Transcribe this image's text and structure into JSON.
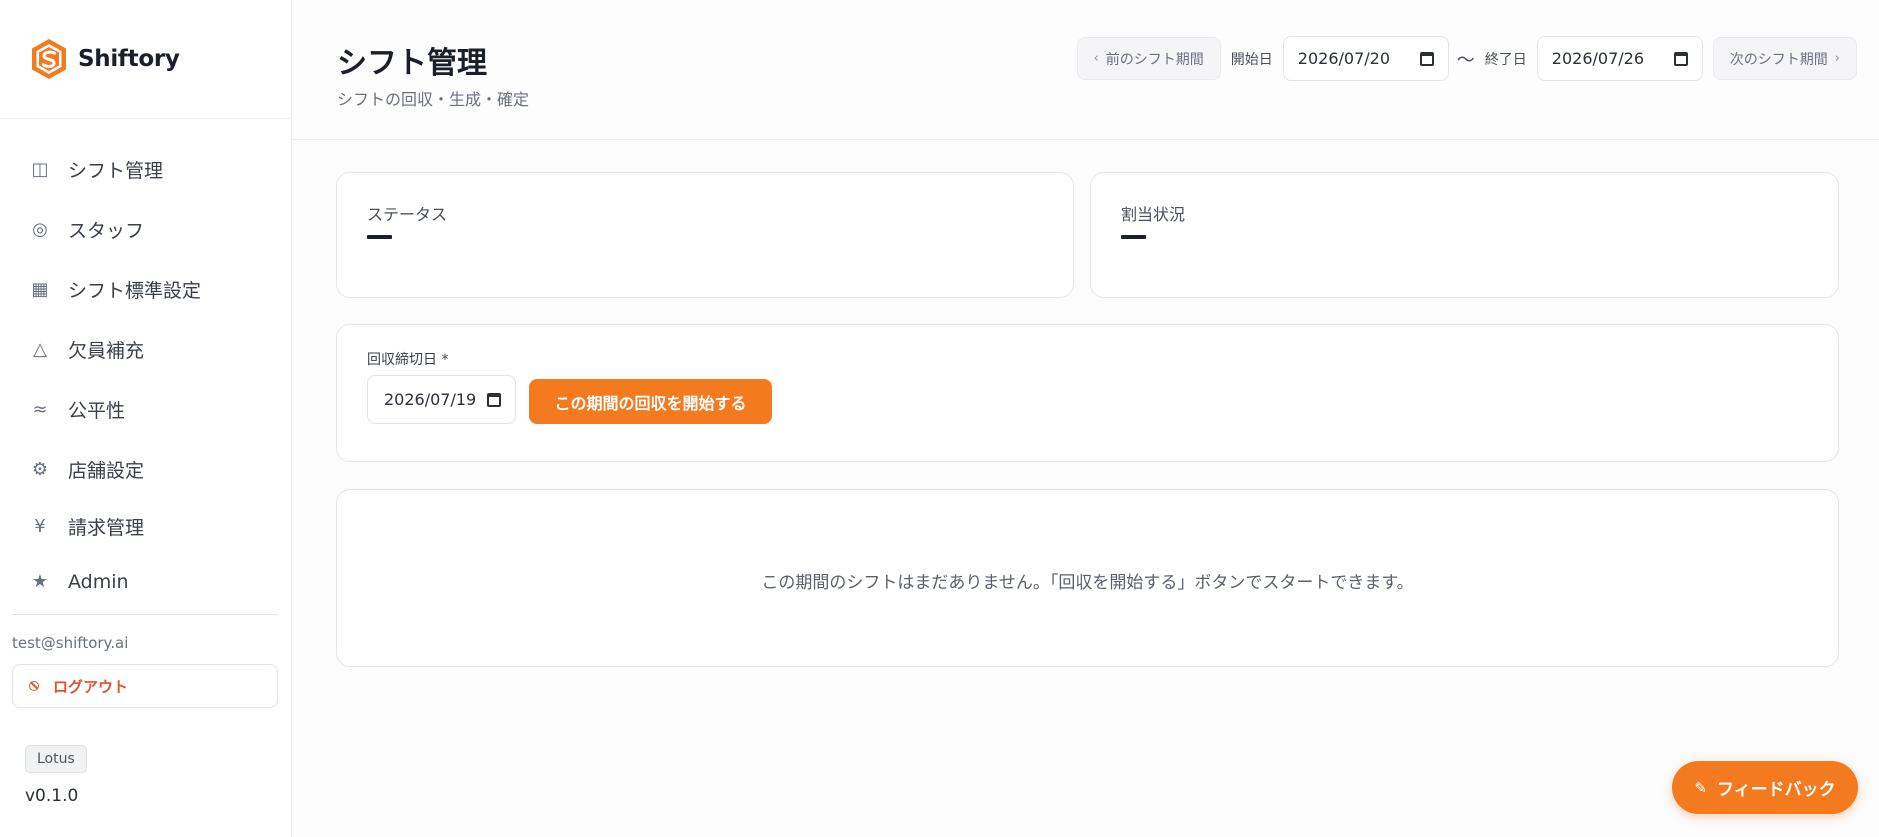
{
  "brand": {
    "name": "Shiftory",
    "accent": "#f47a20"
  },
  "sidebar": {
    "items": [
      {
        "label": "シフト管理",
        "icon": "columns-icon",
        "glyph": "◫"
      },
      {
        "label": "スタッフ",
        "icon": "target-icon",
        "glyph": "◎"
      },
      {
        "label": "シフト標準設定",
        "icon": "grid-icon",
        "glyph": "▦"
      },
      {
        "label": "欠員補充",
        "icon": "triangle-icon",
        "glyph": "△"
      },
      {
        "label": "公平性",
        "icon": "approx-icon",
        "glyph": "≈"
      },
      {
        "label": "店舗設定",
        "icon": "gear-icon",
        "glyph": "⚙"
      },
      {
        "label": "請求管理",
        "icon": "yen-icon",
        "glyph": "¥"
      },
      {
        "label": "Admin",
        "icon": "star-icon",
        "glyph": "★"
      }
    ],
    "user_email": "test@shiftory.ai",
    "logout_label": "ログアウト",
    "plan_badge": "Lotus",
    "version": "v0.1.0"
  },
  "header": {
    "title": "シフト管理",
    "subtitle": "シフトの回収・生成・確定",
    "prev_period_label": "前のシフト期間",
    "next_period_label": "次のシフト期間",
    "start_date_label": "開始日",
    "start_date_value": "2026/07/20",
    "range_separator": "〜",
    "end_date_label": "終了日",
    "end_date_value": "2026/07/26"
  },
  "cards": {
    "status": {
      "title": "ステータス"
    },
    "assignment": {
      "title": "割当状況"
    }
  },
  "collection": {
    "deadline_label": "回収締切日 *",
    "deadline_value": "2026/07/19",
    "start_button_label": "この期間の回収を開始する"
  },
  "empty_state": {
    "message": "この期間のシフトはまだありません。「回収を開始する」ボタンでスタートできます。"
  },
  "feedback": {
    "label": "フィードバック"
  }
}
